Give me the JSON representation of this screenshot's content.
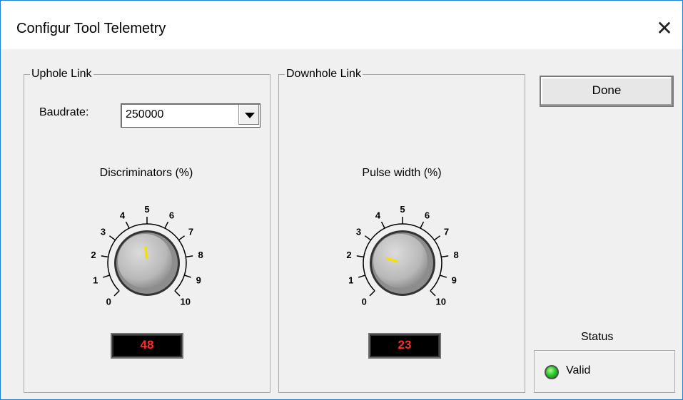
{
  "window": {
    "title": "Configur Tool Telemetry",
    "close_glyph": "✕"
  },
  "uphole": {
    "legend": "Uphole Link",
    "baudrate_label": "Baudrate:",
    "baudrate_value": "250000",
    "knob": {
      "title": "Discriminators (%)",
      "scale_labels": [
        "0",
        "1",
        "2",
        "3",
        "4",
        "5",
        "6",
        "7",
        "8",
        "9",
        "10"
      ],
      "pointer_value": 4.8,
      "readout": "48"
    }
  },
  "downhole": {
    "legend": "Downhole Link",
    "knob": {
      "title": "Pulse width (%)",
      "scale_labels": [
        "0",
        "1",
        "2",
        "3",
        "4",
        "5",
        "6",
        "7",
        "8",
        "9",
        "10"
      ],
      "pointer_value": 2.3,
      "readout": "23"
    }
  },
  "done_label": "Done",
  "status": {
    "label": "Status",
    "text": "Valid",
    "led_color": "#2ecc2e"
  },
  "colors": {
    "readout_text": "#ff2a2a",
    "knob_pointer": "#f5e000",
    "dialog_bg": "#f0f0f0"
  }
}
